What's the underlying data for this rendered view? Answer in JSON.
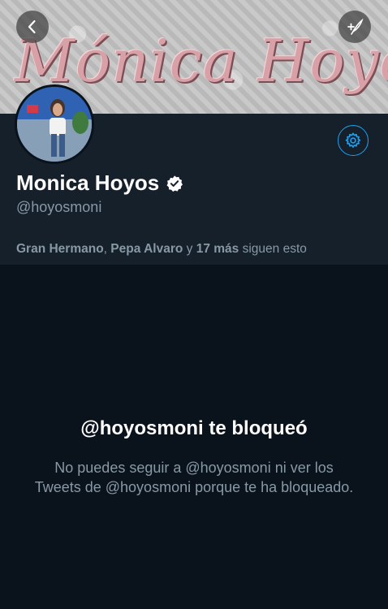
{
  "banner": {
    "text": "Mónica Hoyos"
  },
  "profile": {
    "name": "Monica Hoyos",
    "handle": "@hoyosmoni",
    "verified": true
  },
  "followers_line": {
    "name1": "Gran Hermano",
    "sep1": ",",
    "name2": "Pepa Alvaro",
    "sep2": "y",
    "more": "17 más",
    "suffix": "siguen esto"
  },
  "blocked": {
    "title": "@hoyosmoni te bloqueó",
    "message": "No puedes seguir a @hoyosmoni ni ver los Tweets de @hoyosmoni porque te ha bloqueado."
  },
  "icons": {
    "back": "chevron-left-icon",
    "compose": "compose-feather-icon",
    "settings": "gear-icon",
    "verified": "verified-badge-icon"
  },
  "colors": {
    "background": "#0a121c",
    "header": "#15202b",
    "accent": "#1da1f2",
    "secondary_text": "#8899a6"
  }
}
